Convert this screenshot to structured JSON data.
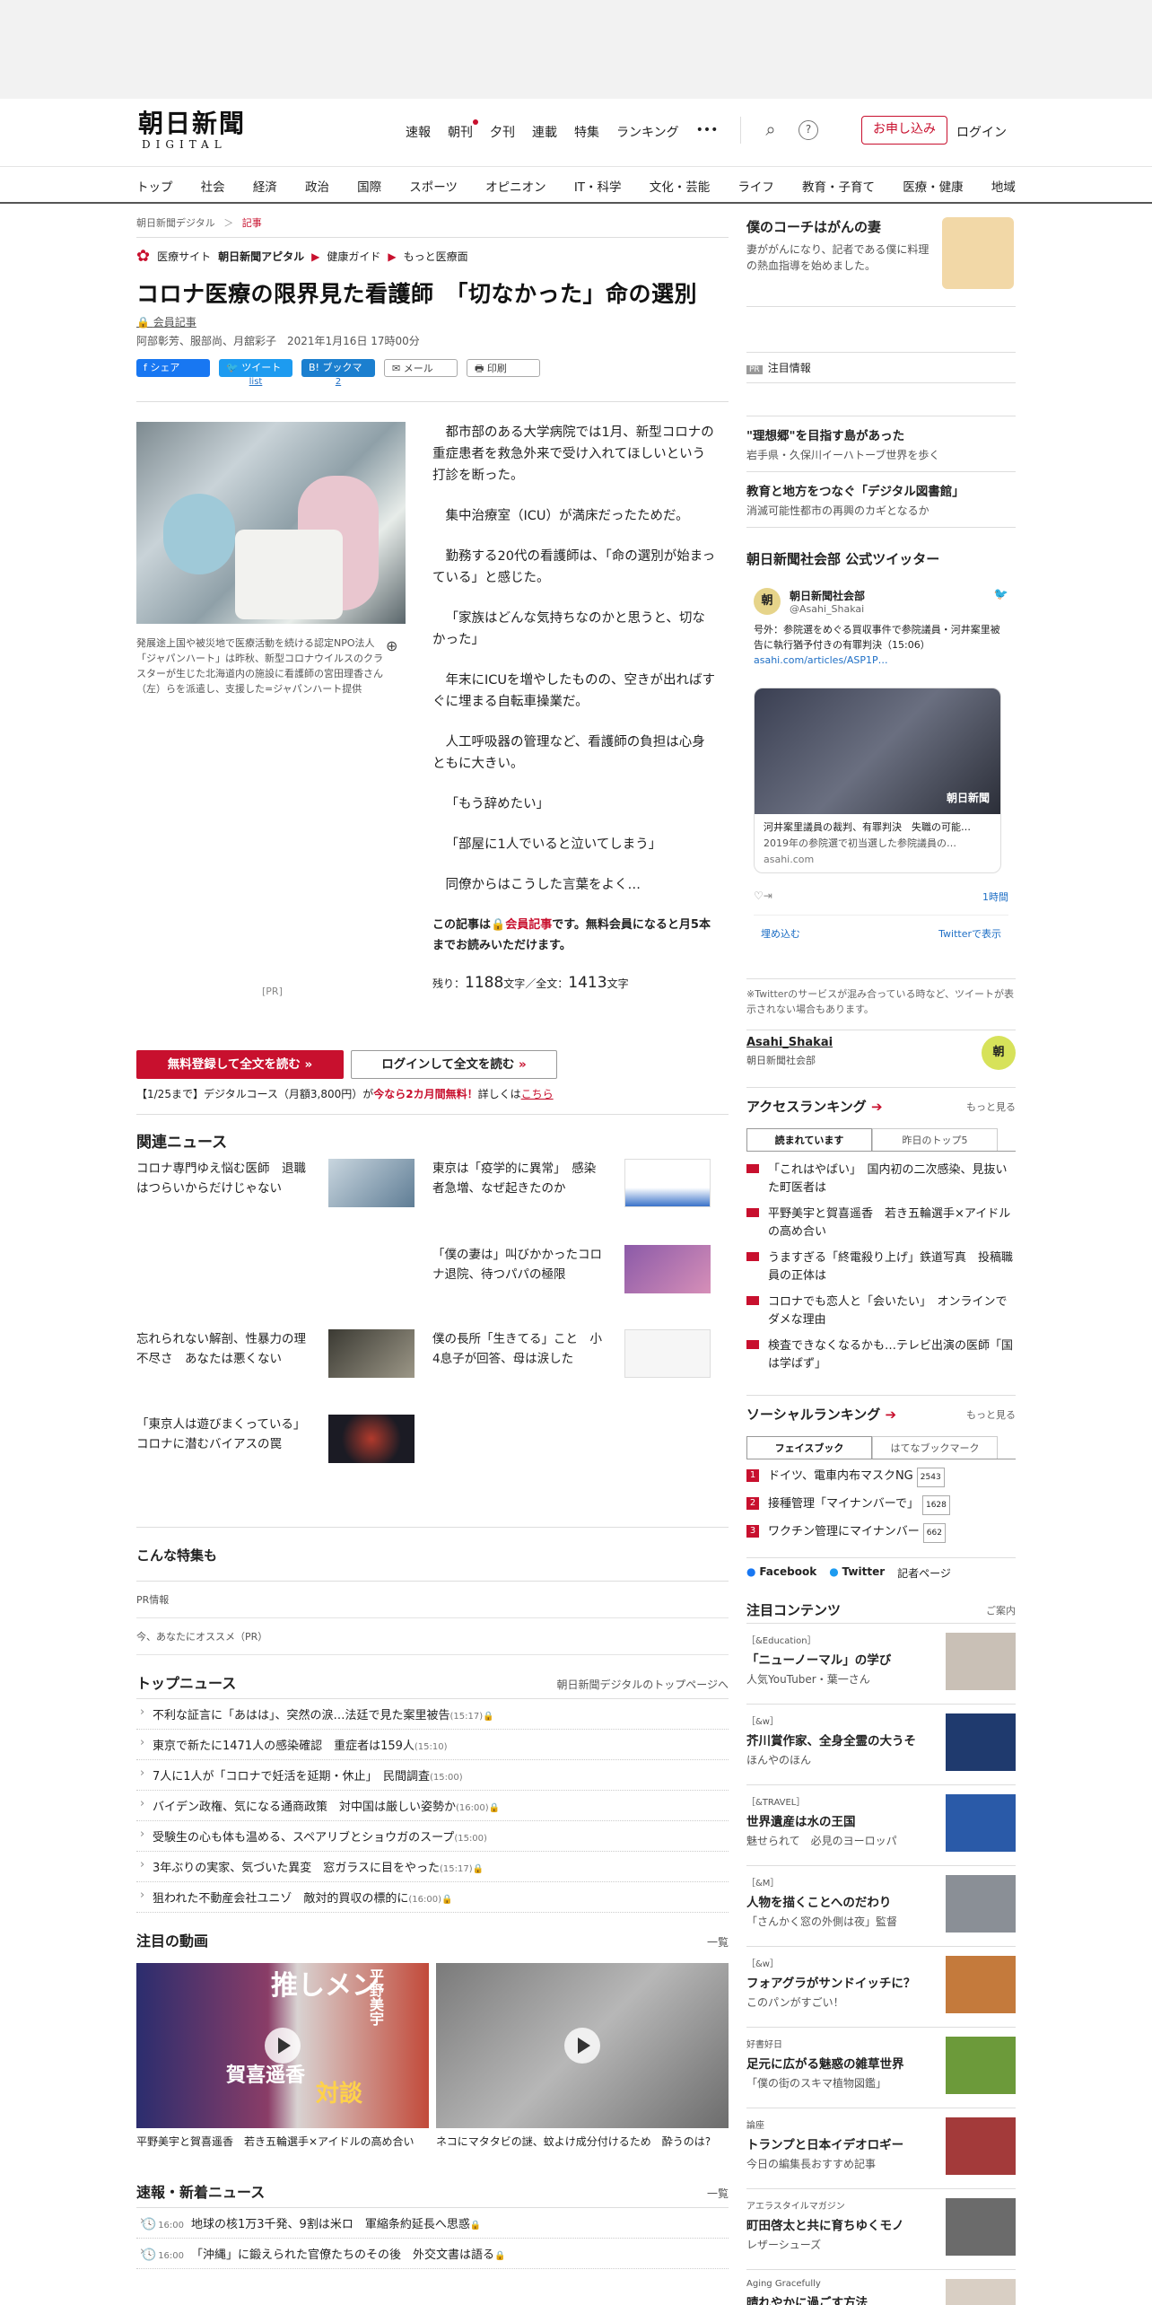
{
  "header": {
    "logo_main": "朝日新聞",
    "logo_sub": "DIGITAL",
    "nav": [
      "速報",
      "朝刊",
      "夕刊",
      "連載",
      "特集",
      "ランキング",
      "•••"
    ],
    "search_glyph": "⌕",
    "help_glyph": "?",
    "subscribe": "お申し込み",
    "login": "ログイン"
  },
  "gnav": [
    "トップ",
    "社会",
    "経済",
    "政治",
    "国際",
    "スポーツ",
    "オピニオン",
    "IT・科学",
    "文化・芸能",
    "ライフ",
    "教育・子育て",
    "医療・健康",
    "地域"
  ],
  "breadcrumb": {
    "home": "朝日新聞デジタル",
    "sep": "＞",
    "current": "記事"
  },
  "medsite": {
    "label": "医療サイト",
    "name": "朝日新聞アピタル",
    "link1": "健康ガイド",
    "link2": "もっと医療面"
  },
  "article": {
    "title": "コロナ医療の限界見た看護師　「切なかった」命の選別",
    "member_label": "会員記事",
    "byline": "阿部彰芳、服部尚、月舘彩子　2021年1月16日 17時00分",
    "share": {
      "facebook": "シェア",
      "tweet": "ツイート",
      "tweet_count": "list",
      "hatena": "ブックマーク",
      "hatena_count": "2",
      "mail": "メール",
      "print": "印刷"
    },
    "caption": "発展途上国や被災地で医療活動を続ける認定NPO法人「ジャパンハート」は昨秋、新型コロナウイルスのクラスターが生じた北海道内の施設に看護師の宮田理香さん（左）らを派遣し、支援した=ジャパンハート提供",
    "pr": "[PR]",
    "paragraphs": [
      "都市部のある大学病院では1月、新型コロナの重症患者を救急外来で受け入れてほしいという打診を断った。",
      "集中治療室（ICU）が満床だったためだ。",
      "勤務する20代の看護師は、「命の選別が始まっている」と感じた。",
      "「家族はどんな気持ちなのかと思うと、切なかった」",
      "年末にICUを増やしたものの、空きが出ればすぐに埋まる自転車操業だ。",
      "人工呼吸器の管理など、看護師の負担は心身ともに大きい。",
      "「もう辞めたい」",
      "「部屋に1人でいると泣いてしまう」",
      "同僚からはこうした言葉をよく…"
    ],
    "member_note_1": "この記事は",
    "member_note_red": "会員記事",
    "member_note_2": "です。無料会員になると月5本までお読みいただけます。",
    "remain_label": "残り：",
    "remain_num": "1188",
    "remain_mid": "文字／全文：",
    "total_num": "1413",
    "remain_end": "文字",
    "cta_register": "無料登録して全文を読む",
    "cta_login": "ログインして全文を読む",
    "promo_1": "【1/25まで】デジタルコース（月額3,800円）が",
    "promo_red": "今なら2カ月間無料！",
    "promo_2": "詳しくは",
    "promo_link": "こちら"
  },
  "related": {
    "heading": "関連ニュース",
    "items": [
      "コロナ専門ゆえ悩む医師　退職はつらいからだけじゃない",
      "東京は「疫学的に異常」　感染者急増、なぜ起きたのか",
      "「僕の妻は」叫びかかったコロナ退院、待つパパの極限",
      "忘れられない解剖、性暴力の理不尽さ　あなたは悪くない",
      "僕の長所「生きてる」こと　小4息子が回答、母は涙した",
      "「東京人は遊びまくっている」コロナに潜むバイアスの罠"
    ]
  },
  "special": {
    "heading": "こんな特集も",
    "pr1": "PR情報",
    "pr2": "今、あなたにオススメ（PR）"
  },
  "topnews": {
    "heading": "トップニュース",
    "more": "朝日新聞デジタルのトップページへ",
    "items": [
      {
        "t": "不利な証言に「あはは」、突然の涙…法廷で見た案里被告",
        "time": "(15:17)"
      },
      {
        "t": "東京で新たに1471人の感染確認　重症者は159人",
        "time": "(15:10)"
      },
      {
        "t": "7人に1人が「コロナで妊活を延期・休止」　民間調査",
        "time": "(15:00)"
      },
      {
        "t": "バイデン政権、気になる通商政策　対中国は厳しい姿勢か",
        "time": "(16:00)"
      },
      {
        "t": "受験生の心も体も温める、スペアリブとショウガのスープ",
        "time": "(15:00)"
      },
      {
        "t": "3年ぶりの実家、気づいた異変　窓ガラスに目をやった",
        "time": "(15:17)"
      },
      {
        "t": "狙われた不動産会社ユニゾ　敵対的買収の標的に",
        "time": "(16:00)"
      }
    ]
  },
  "videos": {
    "heading": "注目の動画",
    "more": "一覧",
    "v1_overlay": "推しメン",
    "v1_overlay2": "平野美宇",
    "v1_overlay3": "賀喜遥香",
    "v1_overlay4": "対談",
    "items": [
      "平野美宇と賀喜遥香　若き五輪選手×アイドルの高め合い",
      "ネコにマタタビの謎、蚊よけ成分付けるため　酔うのは?"
    ]
  },
  "breaking": {
    "heading": "速報・新着ニュース",
    "more": "一覧",
    "items": [
      {
        "time": "16:00",
        "t": "地球の核1万3千発、9割は米ロ　軍縮条約延長へ思惑"
      },
      {
        "time": "16:00",
        "t": "「沖縄」に鍛えられた官僚たちのその後　外交文書は語る"
      }
    ]
  },
  "sidebar": {
    "coach_title": "僕のコーチはがんの妻",
    "coach_desc": "妻ががんになり、記者である僕に料理の熱血指導を始めました。",
    "ad_tag": "PR",
    "ad_label": "注目情報",
    "features": [
      {
        "t": "\"理想郷\"を目指す島があった",
        "s": "岩手県・久保川イーハトーブ世界を歩く"
      },
      {
        "t": "教育と地方をつなぐ「デジタル図書館」",
        "s": "消滅可能性都市の再興のカギとなるか"
      }
    ],
    "twitter_heading": "朝日新聞社会部 公式ツイッター",
    "tw_name": "朝日新聞社会部",
    "tw_handle": "@Asahi_Shakai",
    "tw_text": "号外：参院選をめぐる買収事件で参院議員・河井案里被告に執行猶予付きの有罪判決（15:06）",
    "tw_link": "asahi.com/articles/ASP1P…",
    "tw_card_title": "河井案里議員の裁判、有罪判決　失職の可能…",
    "tw_card_sub": "2019年の参院選で初当選した参院議員の…",
    "tw_card_url": "asahi.com",
    "tw_card_brand": "朝日新聞",
    "tw_time": "1時間",
    "tw_embed": "埋め込む",
    "tw_view": "Twitterで表示",
    "tw_note": "※Twitterのサービスが混み合っている時など、ツイートが表示されない場合もあります。",
    "acct_name": "Asahi_Shakai",
    "acct_sub": "朝日新聞社会部",
    "acct_badge": "朝",
    "access_heading": "アクセスランキング",
    "access_more": "もっと見る",
    "tab_now": "読まれています",
    "tab_yesterday": "昨日のトップ5",
    "access_items": [
      "「これはやばい」　国内初の二次感染、見抜いた町医者は",
      "平野美宇と賀喜遥香　若き五輪選手×アイドルの高め合い",
      "うますぎる「終電殺り上げ」鉄道写真　投稿職員の正体は",
      "コロナでも恋人と「会いたい」　オンラインでダメな理由",
      "検査できなくなるかも…テレビ出演の医師「国は学ばず」"
    ],
    "social_heading": "ソーシャルランキング",
    "social_more": "もっと見る",
    "tab_fb": "フェイスブック",
    "tab_hb": "はてなブックマーク",
    "social_items": [
      {
        "n": "1",
        "t": "ドイツ、電車内布マスクNG",
        "c": "2543"
      },
      {
        "n": "2",
        "t": "接種管理「マイナンバーで」",
        "c": "1628"
      },
      {
        "n": "3",
        "t": "ワクチン管理にマイナンバー",
        "c": "662"
      }
    ],
    "soc_fb": "Facebook",
    "soc_tw": "Twitter",
    "soc_reporter": "記者ページ",
    "pick_heading": "注目コンテンツ",
    "pick_more": "ご案内",
    "picks": [
      {
        "lab": "［&Education］",
        "t": "「ニューノーマル」の学び",
        "s": "人気YouTuber・葉一さん",
        "c": "#c9c0b6"
      },
      {
        "lab": "［&w］",
        "t": "芥川賞作家、全身全霊の大うそ",
        "s": "ほんやのほん",
        "c": "#1f3a6e"
      },
      {
        "lab": "［&TRAVEL］",
        "t": "世界遺産は水の王国",
        "s": "魅せられて　必見のヨーロッパ",
        "c": "#2a5aa8"
      },
      {
        "lab": "［&M］",
        "t": "人物を描くことへのだわり",
        "s": "「さんかく窓の外側は夜」監督",
        "c": "#8a8f96"
      },
      {
        "lab": "［&w］",
        "t": "フォアグラがサンドイッチに？",
        "s": "このパンがすごい！",
        "c": "#c47a3c"
      },
      {
        "lab": "好書好日",
        "t": "足元に広がる魅惑の雑草世界",
        "s": "「僕の街のスキマ植物図鑑」",
        "c": "#6c9a3a"
      },
      {
        "lab": "論座",
        "t": "トランプと日本イデオロギー",
        "s": "今日の編集長おすすめ記事",
        "c": "#a33a3a"
      },
      {
        "lab": "アエラスタイルマガジン",
        "t": "町田啓太と共に育ちゆくモノ",
        "s": "レザーシューズ",
        "c": "#6b6b6b"
      },
      {
        "lab": "Aging Gracefully",
        "t": "晴れやかに過ごす方法",
        "s": "",
        "c": "#d9cfc4"
      }
    ]
  }
}
